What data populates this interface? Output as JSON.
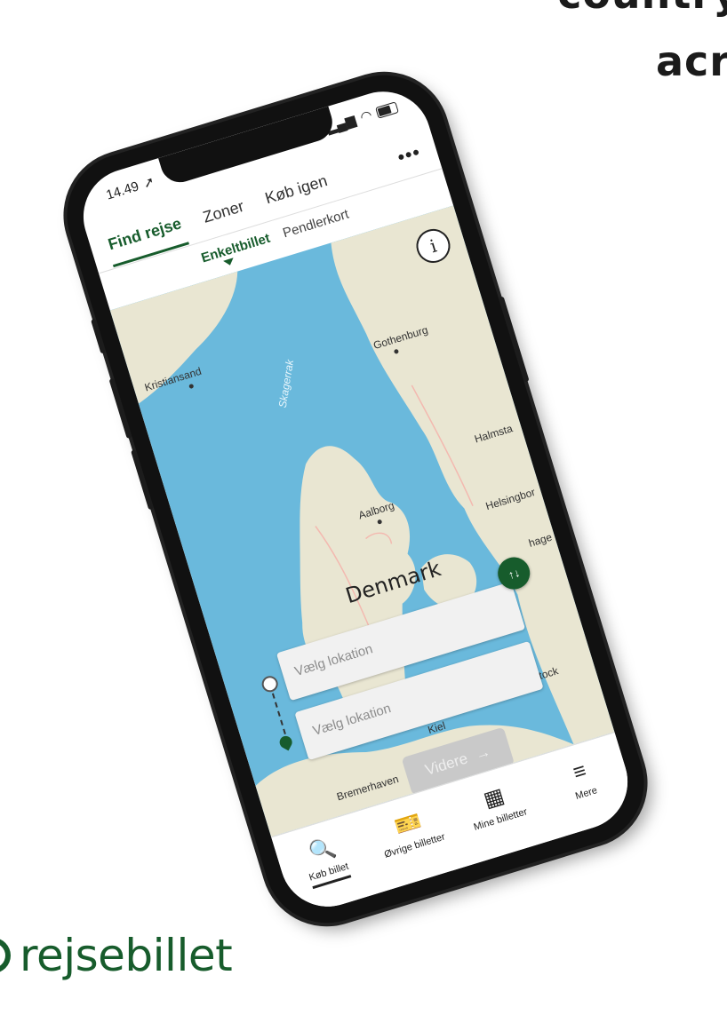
{
  "headline": {
    "line1": "country,",
    "line2": "acr"
  },
  "brand": {
    "name": "rejsebillet"
  },
  "status_bar": {
    "time": "14.49"
  },
  "top_tabs": [
    "Find rejse",
    "Zoner",
    "Køb igen"
  ],
  "more_label": "•••",
  "sub_tabs": [
    "Enkeltbillet",
    "Pendlerkort"
  ],
  "map": {
    "country_label": "Denmark",
    "sea_label": "Skagerrak",
    "places": [
      "Kristiansand",
      "Gothenburg",
      "Aalborg",
      "Halmsta",
      "Helsingbor",
      "hage",
      "Kiel",
      "Rostock",
      "Bremerhaven"
    ]
  },
  "info_icon": "i",
  "from_field": {
    "placeholder": "Vælg lokation"
  },
  "to_field": {
    "placeholder": "Vælg lokation"
  },
  "swap_icon": "↑↓",
  "next_button": {
    "label": "Videre",
    "arrow": "→"
  },
  "bottom_nav": [
    {
      "label": "Køb billet",
      "icon": "search-icon",
      "glyph": "🔍"
    },
    {
      "label": "Øvrige billetter",
      "icon": "ticket-icon",
      "glyph": "🎫"
    },
    {
      "label": "Mine billetter",
      "icon": "qr-code-icon",
      "glyph": "▦"
    },
    {
      "label": "Mere",
      "icon": "menu-icon",
      "glyph": "≡"
    }
  ],
  "colors": {
    "brand_green": "#175c2c",
    "sea": "#6ab9dc",
    "land": "#e9e6d2"
  }
}
